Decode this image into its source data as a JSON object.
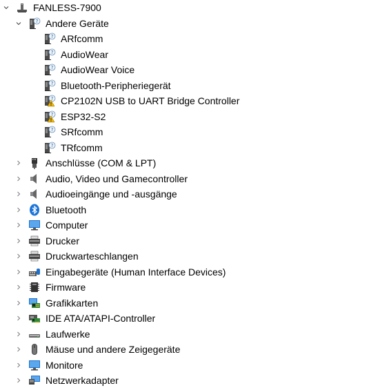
{
  "root": {
    "label": "FANLESS-7900",
    "icon": "computer-tower-icon"
  },
  "expanded_category": {
    "label": "Andere Geräte",
    "icon": "unknown-device-icon",
    "children": [
      {
        "label": "ARfcomm",
        "icon": "unknown-device-icon"
      },
      {
        "label": "AudioWear",
        "icon": "unknown-device-icon"
      },
      {
        "label": "AudioWear Voice",
        "icon": "unknown-device-icon"
      },
      {
        "label": "Bluetooth-Peripheriegerät",
        "icon": "unknown-device-icon"
      },
      {
        "label": "CP2102N USB to UART Bridge Controller",
        "icon": "warning-device-icon"
      },
      {
        "label": "ESP32-S2",
        "icon": "warning-device-icon"
      },
      {
        "label": "SRfcomm",
        "icon": "unknown-device-icon"
      },
      {
        "label": "TRfcomm",
        "icon": "unknown-device-icon"
      }
    ]
  },
  "categories": [
    {
      "label": "Anschlüsse (COM & LPT)",
      "icon": "port-icon"
    },
    {
      "label": "Audio, Video und Gamecontroller",
      "icon": "speaker-icon"
    },
    {
      "label": "Audioeingänge und -ausgänge",
      "icon": "speaker-icon"
    },
    {
      "label": "Bluetooth",
      "icon": "bluetooth-icon"
    },
    {
      "label": "Computer",
      "icon": "monitor-icon"
    },
    {
      "label": "Drucker",
      "icon": "printer-icon"
    },
    {
      "label": "Druckwarteschlangen",
      "icon": "printer-icon"
    },
    {
      "label": "Eingabegeräte (Human Interface Devices)",
      "icon": "hid-icon"
    },
    {
      "label": "Firmware",
      "icon": "chip-icon"
    },
    {
      "label": "Grafikkarten",
      "icon": "display-adapter-icon"
    },
    {
      "label": "IDE ATA/ATAPI-Controller",
      "icon": "controller-card-icon"
    },
    {
      "label": "Laufwerke",
      "icon": "disk-drive-icon"
    },
    {
      "label": "Mäuse und andere Zeigegeräte",
      "icon": "mouse-icon"
    },
    {
      "label": "Monitore",
      "icon": "monitor-icon"
    },
    {
      "label": "Netzwerkadapter",
      "icon": "network-adapter-icon"
    }
  ],
  "colors": {
    "chevron": "#7a7a7a",
    "accent": "#1a74d9",
    "warning": "#f2b705"
  }
}
